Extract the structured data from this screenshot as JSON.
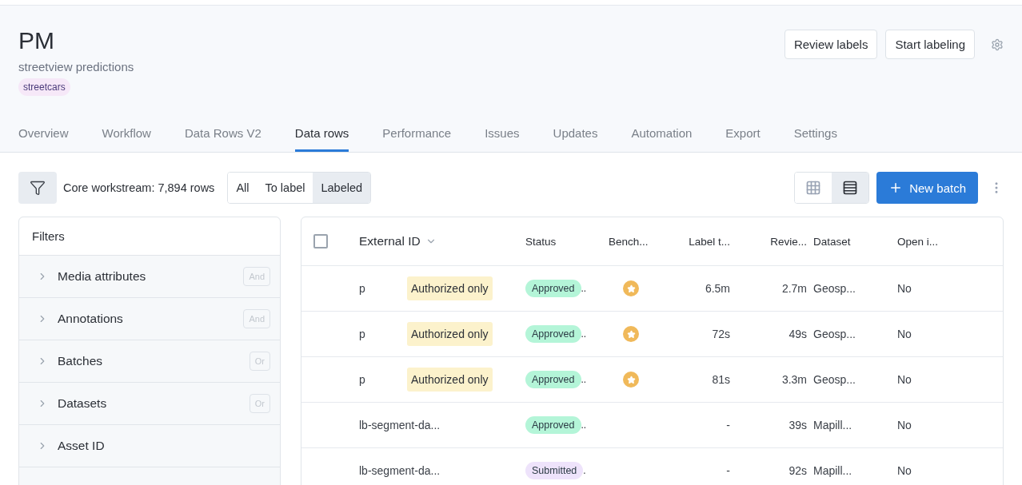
{
  "project": {
    "title": "PM",
    "description": "streetview predictions",
    "tag": "streetcars"
  },
  "header_buttons": [
    "Review labels",
    "Start labeling"
  ],
  "tabs": [
    {
      "label": "Overview",
      "selected": false
    },
    {
      "label": "Workflow",
      "selected": false
    },
    {
      "label": "Data Rows V2",
      "selected": false
    },
    {
      "label": "Data rows",
      "selected": true
    },
    {
      "label": "Performance",
      "selected": false
    },
    {
      "label": "Issues",
      "selected": false
    },
    {
      "label": "Updates",
      "selected": false
    },
    {
      "label": "Automation",
      "selected": false
    },
    {
      "label": "Export",
      "selected": false
    },
    {
      "label": "Settings",
      "selected": false
    }
  ],
  "toolbar": {
    "row_count": "Core workstream: 7,894 rows",
    "segments": [
      {
        "label": "All",
        "selected": false
      },
      {
        "label": "To label",
        "selected": false
      },
      {
        "label": "Labeled",
        "selected": true
      }
    ],
    "views": [
      {
        "kind": "grid",
        "selected": false
      },
      {
        "kind": "list",
        "selected": true
      }
    ],
    "new_button": "New batch"
  },
  "filters": {
    "title": "Filters",
    "items": [
      {
        "label": "Media attributes",
        "operator": "And"
      },
      {
        "label": "Annotations",
        "operator": "And"
      },
      {
        "label": "Batches",
        "operator": "Or"
      },
      {
        "label": "Datasets",
        "operator": "Or"
      },
      {
        "label": "Asset ID"
      }
    ]
  },
  "table": {
    "select_all": {
      "checked": false
    },
    "columns": [
      "External ID",
      "Status",
      "Bench...",
      "Label t...",
      "Revie...",
      "Dataset",
      "Open i..."
    ],
    "rows": [
      {
        "external_id": "p",
        "access": "Authorized only",
        "status": "Approved",
        "color": "#b4f5d8",
        "overflow": "..",
        "benchmark": true,
        "label_time": "6.5m",
        "review_time": "2.7m",
        "dataset": "Geosp...",
        "open_issues": "No"
      },
      {
        "external_id": "p",
        "access": "Authorized only",
        "status": "Approved",
        "color": "#b4f5d8",
        "overflow": "..",
        "benchmark": true,
        "label_time": "72s",
        "review_time": "49s",
        "dataset": "Geosp...",
        "open_issues": "No"
      },
      {
        "external_id": "p",
        "access": "Authorized only",
        "status": "Approved",
        "color": "#b4f5d8",
        "overflow": "..",
        "benchmark": true,
        "label_time": "81s",
        "review_time": "3.3m",
        "dataset": "Geosp...",
        "open_issues": "No"
      },
      {
        "external_id": "lb-segment-da...",
        "status": "Approved",
        "color": "#b4f5d8",
        "overflow": "..",
        "benchmark": false,
        "label_time": "-",
        "review_time": "39s",
        "dataset": "Mapill...",
        "open_issues": "No"
      },
      {
        "external_id": "lb-segment-da...",
        "status": "Submitted",
        "color": "#eee3fb",
        "overflow": ".",
        "benchmark": false,
        "label_time": "-",
        "review_time": "92s",
        "dataset": "Mapill...",
        "open_issues": "No"
      }
    ]
  }
}
